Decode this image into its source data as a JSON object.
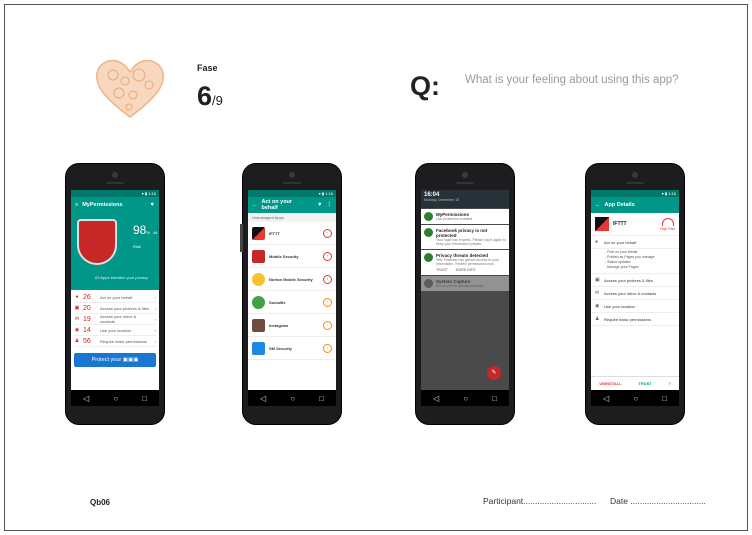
{
  "header": {
    "phase_label": "Fase",
    "step_current": "6",
    "step_total": "/9",
    "q_label": "Q:",
    "question": "What is your feeling about using this app?"
  },
  "footer": {
    "code": "Qb06",
    "participant": "Participant...............................",
    "date": "Date ................................"
  },
  "phone1": {
    "title": "MyPermissions",
    "score": "98",
    "score_unit": "%",
    "score_note": "At Risk",
    "apps_line": "63 Apps threaten your privacy",
    "items": [
      {
        "icon": "chat-icon",
        "count": "26",
        "label": "Act on your behalf"
      },
      {
        "icon": "image-icon",
        "count": "20",
        "label": "Access your pictures & files"
      },
      {
        "icon": "mail-icon",
        "count": "19",
        "label": "Access your inbox & contacts"
      },
      {
        "icon": "location-icon",
        "count": "14",
        "label": "Use your location"
      },
      {
        "icon": "person-icon",
        "count": "56",
        "label": "Require basic permissions"
      }
    ],
    "protect_label": "Protect your"
  },
  "phone2": {
    "title": "Act on your behalf",
    "section": "Unmanaged Apps",
    "apps": [
      {
        "name": "IFTTT",
        "color": "#111111",
        "risk": "high"
      },
      {
        "name": "Mobile Security",
        "color": "#c62828",
        "risk": "high"
      },
      {
        "name": "Norton Mobile Security",
        "color": "#fbc02d",
        "risk": "high"
      },
      {
        "name": "Socialfix",
        "color": "#43a047",
        "risk": "med"
      },
      {
        "name": "Instagram",
        "color": "#6d4c41",
        "risk": "med"
      },
      {
        "name": "SM Security",
        "color": "#1e88e5",
        "risk": "med"
      }
    ]
  },
  "phone3": {
    "time": "16:04",
    "date": "Monday, December 15",
    "notifs": [
      {
        "title": "MyPermissions",
        "desc": "Live protection enabled",
        "actions": [
          "",
          ""
        ]
      },
      {
        "title": "Facebook privacy is not protected",
        "desc": "Your login has expired. Please log in again to keep your information private.",
        "actions": [
          "",
          ""
        ]
      },
      {
        "title": "Privacy threats detected",
        "desc": "WW Pinterest has gained access to your information. Review permissions now.",
        "actions": [
          "TRUST",
          "MORE INFO"
        ]
      },
      {
        "title": "System Capture",
        "desc": "Ru.sm phone activity recorded",
        "actions": [
          "",
          ""
        ]
      }
    ]
  },
  "phone4": {
    "title": "App Details",
    "app_name": "IFTTT",
    "risk_label": "High Risk",
    "act_label": "Act on your behalf",
    "bullets": [
      "Post on your behalf",
      "Publish as Pages you manage",
      "Status updates",
      "Manage your Pages"
    ],
    "rows": [
      {
        "icon": "image-icon",
        "label": "Access your pictures & files"
      },
      {
        "icon": "mail-icon",
        "label": "Access your inbox & contacts"
      },
      {
        "icon": "location-icon",
        "label": "Use your location"
      },
      {
        "icon": "person-icon",
        "label": "Require basic permissions"
      }
    ],
    "uninstall": "UNINSTALL",
    "trust": "TRUST"
  },
  "colors": {
    "teal": "#009688",
    "red": "#c62828",
    "blue": "#1976d2",
    "heart": "#f5c9a6"
  }
}
